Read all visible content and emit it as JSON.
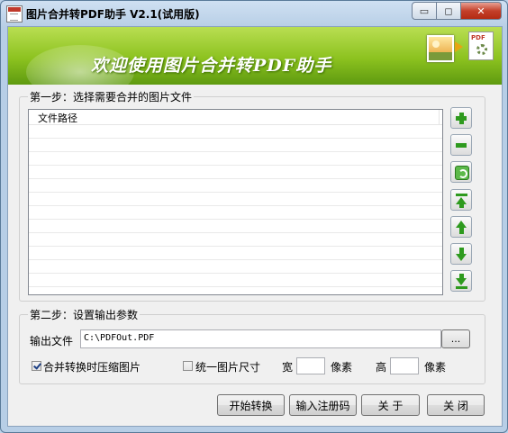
{
  "window": {
    "title": "图片合并转PDF助手 V2.1(试用版)",
    "controls": {
      "minimize": "▭",
      "maximize": "◻",
      "close": "✕"
    }
  },
  "banner": {
    "text": "欢迎使用图片合并转PDF助手",
    "pdf_tag": "PDF",
    "icons": [
      "image-icon",
      "arrow-icon",
      "pdf-gear-icon"
    ]
  },
  "step1": {
    "legend": "第一步：选择需要合并的图片文件",
    "list_header": "文件路径",
    "files": []
  },
  "toolbar_icons": [
    "add-icon",
    "remove-icon",
    "clear-icon",
    "move-top-icon",
    "move-up-icon",
    "move-down-icon",
    "move-bottom-icon"
  ],
  "step2": {
    "legend": "第二步：设置输出参数",
    "output_label": "输出文件",
    "output_value": "C:\\PDFOut.PDF",
    "browse_label": "...",
    "compress_label": "合并转换时压缩图片",
    "compress_checked": true,
    "unify_label": "统一图片尺寸",
    "unify_checked": false,
    "width_label": "宽",
    "width_value": "",
    "width_unit": "像素",
    "height_label": "高",
    "height_value": "",
    "height_unit": "像素"
  },
  "buttons": {
    "start": "开始转换",
    "register": "输入注册码",
    "about": "关 于",
    "close": "关 闭"
  }
}
